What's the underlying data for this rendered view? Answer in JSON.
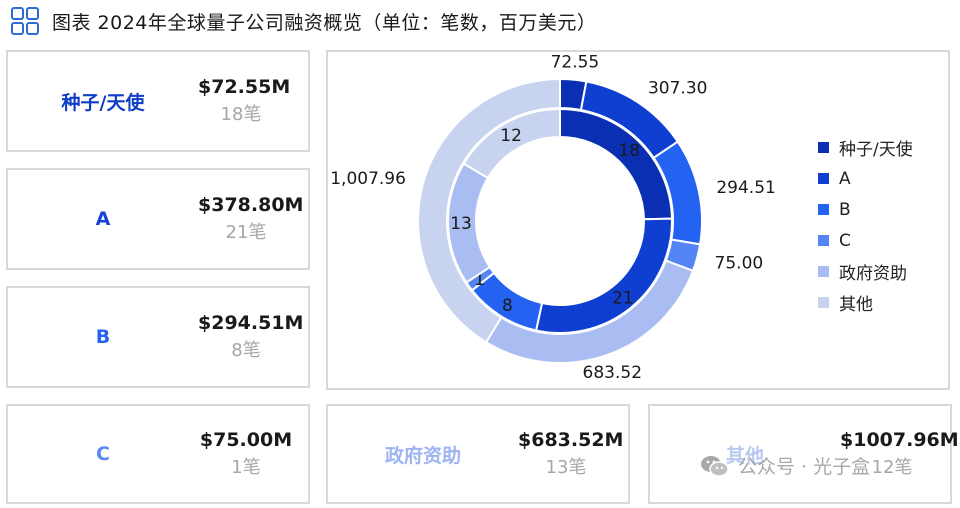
{
  "header": {
    "title": "图表  2024年全球量子公司融资概览（单位：笔数，百万美元）",
    "icon": "grid-icon"
  },
  "cards": [
    {
      "label": "种子/天使",
      "amount": "$72.55M",
      "count": "18笔",
      "color": "#0f3cc9"
    },
    {
      "label": "A",
      "amount": "$378.80M",
      "count": "21笔",
      "color": "#1541d8"
    },
    {
      "label": "B",
      "amount": "$294.51M",
      "count": "8笔",
      "color": "#2662f0"
    },
    {
      "label": "C",
      "amount": "$75.00M",
      "count": "1笔",
      "color": "#5b87f2"
    },
    {
      "label": "政府资助",
      "amount": "$683.52M",
      "count": "13笔",
      "color": "#9db4f2"
    },
    {
      "label": "其他",
      "amount": "$1007.96M",
      "count": "12笔",
      "color": "#b8c9f0"
    }
  ],
  "chart_data": {
    "type": "donut",
    "categories": [
      "种子/天使",
      "A",
      "B",
      "C",
      "政府资助",
      "其他"
    ],
    "colors": [
      "#0a2fb3",
      "#0e3fd1",
      "#2462f2",
      "#5585f4",
      "#a9bdf2",
      "#c7d3ef"
    ],
    "series": [
      {
        "ring": "outer",
        "unit": "百万美元",
        "values": [
          72.55,
          307.3,
          294.51,
          75.0,
          683.52,
          1007.96
        ],
        "labels": [
          "72.55",
          "307.30",
          "294.51",
          "75.00",
          "683.52",
          "1,007.96"
        ]
      },
      {
        "ring": "inner",
        "unit": "笔数",
        "values": [
          18,
          21,
          8,
          1,
          13,
          12
        ],
        "labels": [
          "18",
          "21",
          "8",
          "1",
          "13",
          "12"
        ]
      }
    ],
    "legend_position": "right"
  },
  "watermark": {
    "text": "公众号 · 光子盒",
    "icon": "wechat-icon"
  }
}
